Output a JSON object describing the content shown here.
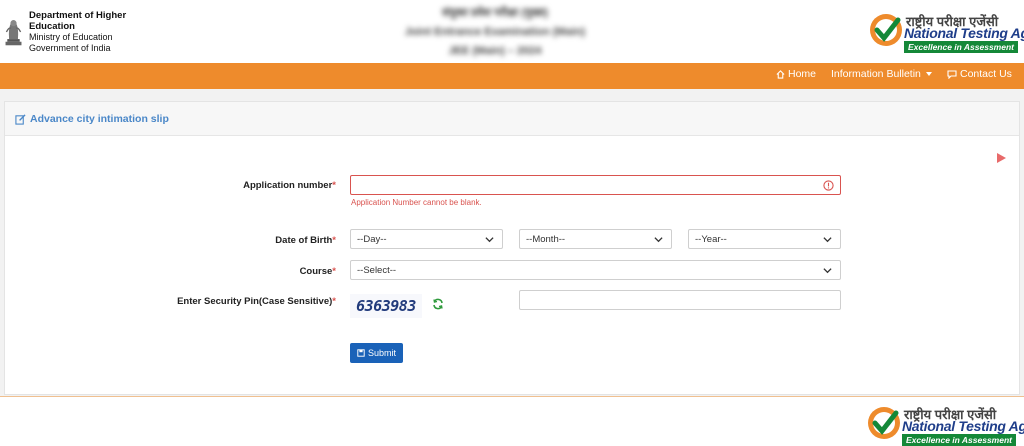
{
  "header": {
    "dept_line1": "Department of Higher Education",
    "dept_line2": "Ministry of Education",
    "dept_line3": "Government of India",
    "center_line1": "संयुक्त प्रवेश परीक्षा (मुख्य)",
    "center_line2": "Joint Entrance Examination (Main)",
    "center_line3": "JEE (Main) – 2024",
    "nta_hindi": "राष्ट्रीय परीक्षा एजेंसी",
    "nta_english": "National Testing Agency",
    "nta_tagline": "Excellence in Assessment"
  },
  "nav": {
    "home": "Home",
    "info_bulletin": "Information Bulletin",
    "contact": "Contact Us"
  },
  "card": {
    "title": "Advance city intimation slip"
  },
  "form": {
    "application_label": "Application number",
    "application_value": "",
    "application_error": "Application Number cannot be blank.",
    "dob_label": "Date of Birth",
    "dob_day": "--Day--",
    "dob_month": "--Month--",
    "dob_year": "--Year--",
    "course_label": "Course",
    "course_value": "--Select--",
    "pin_label": "Enter Security Pin(Case Sensitive)",
    "captcha_text": "6363983",
    "pin_value": "",
    "submit_label": "Submit",
    "required_mark": "*"
  },
  "colors": {
    "nav_bg": "#ee8b2c",
    "title_blue": "#4a87c8",
    "error_red": "#d9534f",
    "submit_blue": "#1a62b8",
    "nta_green": "#148838"
  }
}
